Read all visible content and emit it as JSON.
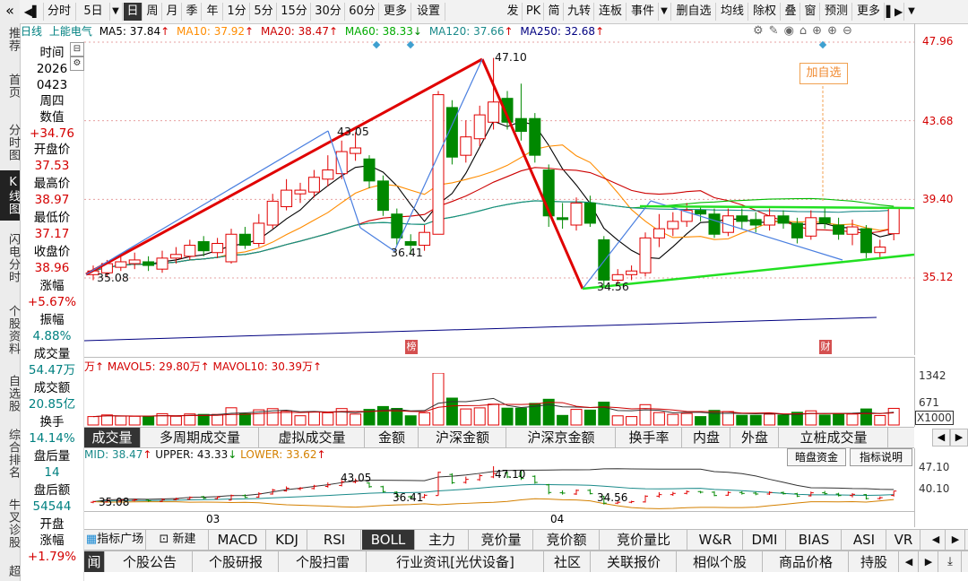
{
  "left_nav": {
    "collapse_glyph": "«",
    "items": [
      {
        "label": "推荐"
      },
      {
        "label": "首页"
      },
      {
        "label": "分时图"
      },
      {
        "label": "K线图",
        "active": true
      },
      {
        "label": "闪电分时"
      },
      {
        "label": "个股资料"
      },
      {
        "label": "自选股"
      },
      {
        "label": "综合排名"
      },
      {
        "label": "牛叉诊股"
      },
      {
        "label": "超"
      }
    ]
  },
  "toolbar": {
    "items": [
      "分时",
      "5日",
      "日",
      "周",
      "月",
      "季",
      "年",
      "1分",
      "5分",
      "15分",
      "30分",
      "60分",
      "更多",
      "设置",
      "发",
      "PK",
      "简",
      "九转",
      "连板",
      "事件",
      "删自选",
      "均线",
      "除权",
      "叠",
      "窗",
      "预测",
      "更多"
    ],
    "selected": "日"
  },
  "ma_line": {
    "title": "日线",
    "stock": "上能电气",
    "ma5": "MA5: 37.84",
    "ma10": "MA10: 37.92",
    "ma20": "MA20: 38.47",
    "ma60": "MA60: 38.33",
    "ma120": "MA120: 37.66",
    "ma250": "MA250: 32.68",
    "colors": {
      "ma5": "#000000",
      "ma10": "#ff8c00",
      "ma20": "#cc0000",
      "ma60": "#00bb00",
      "ma120": "#1a8a8a",
      "ma250": "#000080"
    }
  },
  "info_panel": {
    "rows": [
      {
        "label": "时间",
        "value": "2026"
      },
      {
        "label": "0423",
        "value": "周四"
      },
      {
        "label": "数值",
        "value": "+34.76"
      },
      {
        "label": "开盘价",
        "value": "37.53"
      },
      {
        "label": "最高价",
        "value": "38.97"
      },
      {
        "label": "最低价",
        "value": "37.17"
      },
      {
        "label": "收盘价",
        "value": "38.96"
      },
      {
        "label": "涨幅",
        "value": "+5.67%"
      },
      {
        "label": "振幅",
        "value": "4.88%"
      },
      {
        "label": "成交量",
        "value": "54.47万"
      },
      {
        "label": "成交额",
        "value": "20.85亿"
      },
      {
        "label": "换手",
        "value": "14.14%"
      },
      {
        "label": "盘后量",
        "value": "14"
      },
      {
        "label": "盘后额",
        "value": "54544"
      },
      {
        "label": "开盘",
        "value": "涨幅"
      },
      {
        "label": "+1.79%",
        "value": ""
      }
    ]
  },
  "chart_data": [
    {
      "type": "candlestick",
      "title": "日线 上能电气",
      "y_axis_ticks": [
        "47.96",
        "43.68",
        "39.40",
        "35.12"
      ],
      "annotations": [
        "47.10",
        "43.05",
        "36.41",
        "35.08",
        "34.56",
        "加自选",
        "榜",
        "财"
      ],
      "candles": [
        {
          "o": 35.3,
          "c": 35.5,
          "h": 35.8,
          "l": 35.0
        },
        {
          "o": 35.4,
          "c": 35.9,
          "h": 36.1,
          "l": 35.2
        },
        {
          "o": 35.7,
          "c": 36.0,
          "h": 36.3,
          "l": 35.5
        },
        {
          "o": 35.9,
          "c": 36.1,
          "h": 36.5,
          "l": 35.6
        },
        {
          "o": 36.0,
          "c": 35.8,
          "h": 36.3,
          "l": 35.5
        },
        {
          "o": 35.6,
          "c": 36.2,
          "h": 36.6,
          "l": 35.4
        },
        {
          "o": 36.2,
          "c": 36.4,
          "h": 36.8,
          "l": 35.9
        },
        {
          "o": 36.3,
          "c": 36.9,
          "h": 37.2,
          "l": 36.1
        },
        {
          "o": 37.1,
          "c": 36.6,
          "h": 37.4,
          "l": 36.3
        },
        {
          "o": 36.5,
          "c": 37.0,
          "h": 37.3,
          "l": 36.2
        },
        {
          "o": 36.0,
          "c": 37.5,
          "h": 37.8,
          "l": 35.9
        },
        {
          "o": 37.5,
          "c": 36.9,
          "h": 37.9,
          "l": 36.7
        },
        {
          "o": 37.0,
          "c": 38.1,
          "h": 38.6,
          "l": 36.8
        },
        {
          "o": 38.0,
          "c": 39.3,
          "h": 39.7,
          "l": 37.8
        },
        {
          "o": 39.0,
          "c": 39.9,
          "h": 40.5,
          "l": 38.8
        },
        {
          "o": 39.7,
          "c": 39.9,
          "h": 40.3,
          "l": 39.2
        },
        {
          "o": 39.8,
          "c": 40.6,
          "h": 41.0,
          "l": 39.5
        },
        {
          "o": 40.5,
          "c": 41.0,
          "h": 41.8,
          "l": 40.1
        },
        {
          "o": 40.8,
          "c": 42.0,
          "h": 42.6,
          "l": 40.5
        },
        {
          "o": 41.9,
          "c": 42.2,
          "h": 43.05,
          "l": 41.5
        },
        {
          "o": 41.6,
          "c": 40.4,
          "h": 41.8,
          "l": 40.0
        },
        {
          "o": 40.4,
          "c": 38.8,
          "h": 40.7,
          "l": 38.5
        },
        {
          "o": 38.6,
          "c": 37.3,
          "h": 38.9,
          "l": 36.9
        },
        {
          "o": 37.1,
          "c": 36.9,
          "h": 37.5,
          "l": 36.41
        },
        {
          "o": 36.9,
          "c": 37.6,
          "h": 38.0,
          "l": 36.6
        },
        {
          "o": 37.5,
          "c": 45.1,
          "h": 45.3,
          "l": 37.5
        },
        {
          "o": 44.4,
          "c": 41.7,
          "h": 44.8,
          "l": 41.3
        },
        {
          "o": 41.8,
          "c": 42.8,
          "h": 43.7,
          "l": 41.4
        },
        {
          "o": 42.7,
          "c": 44.0,
          "h": 44.5,
          "l": 42.3
        },
        {
          "o": 43.6,
          "c": 44.7,
          "h": 47.1,
          "l": 43.2
        },
        {
          "o": 44.9,
          "c": 43.6,
          "h": 45.3,
          "l": 43.2
        },
        {
          "o": 43.8,
          "c": 43.1,
          "h": 45.7,
          "l": 42.6
        },
        {
          "o": 43.8,
          "c": 41.8,
          "h": 44.1,
          "l": 41.4
        },
        {
          "o": 41.0,
          "c": 38.5,
          "h": 41.3,
          "l": 37.9
        },
        {
          "o": 38.4,
          "c": 38.3,
          "h": 39.2,
          "l": 37.8
        },
        {
          "o": 38.0,
          "c": 39.2,
          "h": 39.5,
          "l": 37.7
        },
        {
          "o": 39.2,
          "c": 38.1,
          "h": 39.6,
          "l": 37.9
        },
        {
          "o": 37.2,
          "c": 35.0,
          "h": 37.4,
          "l": 34.56
        },
        {
          "o": 35.0,
          "c": 35.3,
          "h": 35.6,
          "l": 34.7
        },
        {
          "o": 35.3,
          "c": 35.5,
          "h": 35.8,
          "l": 35.0
        },
        {
          "o": 35.4,
          "c": 37.3,
          "h": 37.6,
          "l": 35.2
        },
        {
          "o": 37.3,
          "c": 37.8,
          "h": 38.6,
          "l": 36.8
        },
        {
          "o": 37.8,
          "c": 38.2,
          "h": 38.7,
          "l": 37.4
        },
        {
          "o": 38.2,
          "c": 38.8,
          "h": 39.2,
          "l": 37.9
        },
        {
          "o": 38.8,
          "c": 38.6,
          "h": 39.0,
          "l": 38.2
        },
        {
          "o": 38.6,
          "c": 37.5,
          "h": 38.9,
          "l": 37.3
        },
        {
          "o": 37.6,
          "c": 38.5,
          "h": 38.9,
          "l": 37.4
        },
        {
          "o": 38.5,
          "c": 38.2,
          "h": 38.9,
          "l": 37.8
        },
        {
          "o": 38.3,
          "c": 38.0,
          "h": 38.7,
          "l": 37.6
        },
        {
          "o": 38.0,
          "c": 38.5,
          "h": 38.9,
          "l": 37.7
        },
        {
          "o": 38.5,
          "c": 38.1,
          "h": 38.8,
          "l": 37.8
        },
        {
          "o": 38.1,
          "c": 37.3,
          "h": 38.4,
          "l": 37.0
        },
        {
          "o": 37.4,
          "c": 38.4,
          "h": 38.8,
          "l": 37.2
        },
        {
          "o": 38.4,
          "c": 38.1,
          "h": 39.0,
          "l": 37.8
        },
        {
          "o": 38.0,
          "c": 37.5,
          "h": 38.4,
          "l": 37.2
        },
        {
          "o": 37.5,
          "c": 37.9,
          "h": 38.3,
          "l": 36.9
        },
        {
          "o": 37.8,
          "c": 36.5,
          "h": 38.0,
          "l": 36.2
        },
        {
          "o": 36.5,
          "c": 36.8,
          "h": 37.2,
          "l": 36.2
        },
        {
          "o": 37.53,
          "c": 38.96,
          "h": 38.97,
          "l": 37.17
        }
      ]
    },
    {
      "type": "bar",
      "title": "成交量",
      "legend": {
        "vol": "万",
        "mavol5": "MAVOL5: 29.80万",
        "mavol10": "MAVOL10: 30.39万"
      },
      "y_axis_ticks": [
        "1342",
        "671",
        "X1000"
      ]
    },
    {
      "type": "line",
      "title": "BOLL",
      "legend": {
        "mid": "MID: 38.47",
        "upper": "UPPER: 43.33",
        "lower": "LOWER: 33.62"
      },
      "y_axis_ticks": [
        "47.10",
        "40.10"
      ],
      "x_labels": [
        "03",
        "04"
      ],
      "annotations": [
        "43.05",
        "47.10",
        "36.41",
        "34.56",
        "35.08"
      ]
    }
  ],
  "vol_tabs": [
    "成交量",
    "多周期成交量",
    "虚拟成交量",
    "金额",
    "沪深金额",
    "沪深京金额",
    "换手率",
    "内盘",
    "外盘",
    "立桩成交量"
  ],
  "ind_buttons": {
    "hidden_fund": "暗盘资金",
    "ind_desc": "指标说明"
  },
  "indicator_tabs": [
    "指标广场",
    "新建",
    "MACD",
    "KDJ",
    "RSI",
    "BOLL",
    "主力",
    "竞价量",
    "竞价额",
    "竞价量比",
    "W&R",
    "DMI",
    "BIAS",
    "ASI",
    "VR"
  ],
  "indicator_selected": "BOLL",
  "bottom_tabs": [
    "闻",
    "个股公告",
    "个股研报",
    "个股扫雷",
    "行业资讯[光伏设备]",
    "社区",
    "关联报价",
    "相似个股",
    "商品价格",
    "持股"
  ]
}
